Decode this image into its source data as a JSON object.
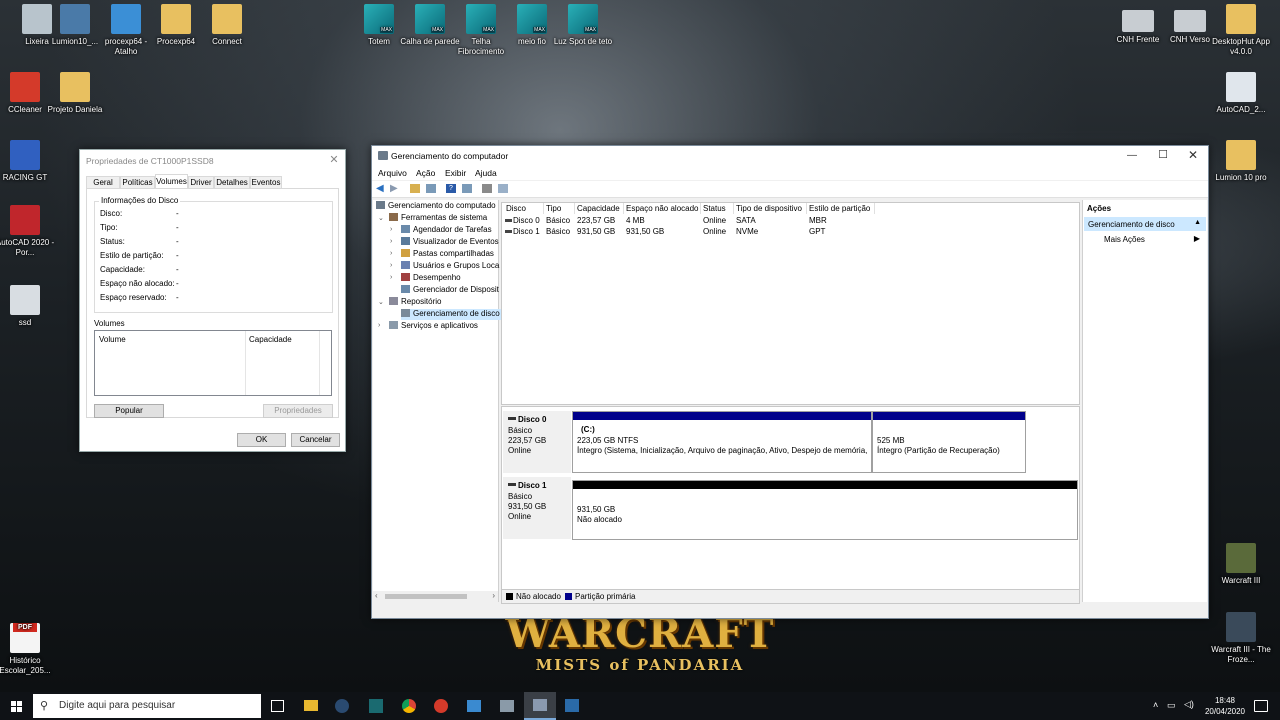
{
  "desktop": {
    "icons_left": [
      {
        "label": "Lixeira",
        "color": "#b8c4cc"
      },
      {
        "label": "Lumion10_...",
        "color": "#4a7aa8"
      },
      {
        "label": "procexp64 - Atalho",
        "color": "#3b8fd6"
      },
      {
        "label": "Procexp64",
        "color": "#e8c060"
      },
      {
        "label": "Connect",
        "color": "#e8c060"
      },
      {
        "label": "CCleaner",
        "color": "#d43a2a"
      },
      {
        "label": "Projeto Daniela",
        "color": "#e8c060"
      },
      {
        "label": "RACING GT",
        "color": "#3060c0"
      },
      {
        "label": "AutoCAD 2020 - Por...",
        "color": "#c0262c"
      },
      {
        "label": "ssd",
        "color": "#d8dde2"
      },
      {
        "label": "Histórico Escolar_205...",
        "color": "#d8dde2"
      }
    ],
    "icons_max": [
      {
        "label": "Totem"
      },
      {
        "label": "Calha de parede"
      },
      {
        "label": "Telha Fibrocimento"
      },
      {
        "label": "meio fio"
      },
      {
        "label": "Luz Spot de teto"
      }
    ],
    "max_badge": "MAX",
    "icons_right": [
      {
        "label": "CNH Frente",
        "color": "#c8cdd2"
      },
      {
        "label": "CNH Verso",
        "color": "#c8cdd2"
      },
      {
        "label": "DesktopHut App v4.0.0",
        "color": "#e8c060"
      },
      {
        "label": "AutoCAD_2...",
        "color": "#e0e6ec"
      },
      {
        "label": "Lumion 10 pro",
        "color": "#e8c060"
      },
      {
        "label": "Warcraft III",
        "color": "#5a6a3a"
      },
      {
        "label": "Warcraft III - The Froze...",
        "color": "#3a4a5a"
      }
    ],
    "pdf_badge": "PDF",
    "wallpaper_title": "WARCRAFT",
    "wallpaper_subtitle": "MISTS of PANDARIA"
  },
  "props": {
    "title": "Propriedades de CT1000P1SSD8",
    "tabs": [
      "Geral",
      "Políticas",
      "Volumes",
      "Driver",
      "Detalhes",
      "Eventos"
    ],
    "active_tab": 2,
    "group_title": "Informações do Disco",
    "rows": [
      {
        "label": "Disco:",
        "value": "-"
      },
      {
        "label": "Tipo:",
        "value": "-"
      },
      {
        "label": "Status:",
        "value": "-"
      },
      {
        "label": "Estilo de partição:",
        "value": "-"
      },
      {
        "label": "Capacidade:",
        "value": "-"
      },
      {
        "label": "Espaço não alocado:",
        "value": "-"
      },
      {
        "label": "Espaço reservado:",
        "value": "-"
      }
    ],
    "volumes_label": "Volumes",
    "vol_col1": "Volume",
    "vol_col2": "Capacidade",
    "populate": "Popular",
    "properties": "Propriedades",
    "ok": "OK",
    "cancel": "Cancelar"
  },
  "cm": {
    "title": "Gerenciamento do computador",
    "menu": [
      "Arquivo",
      "Ação",
      "Exibir",
      "Ajuda"
    ],
    "tree": [
      {
        "label": "Gerenciamento do computado",
        "level": 0,
        "exp": "",
        "color": "#6a7a8a"
      },
      {
        "label": "Ferramentas de sistema",
        "level": 1,
        "exp": "v",
        "color": "#8a6a4a"
      },
      {
        "label": "Agendador de Tarefas",
        "level": 2,
        "exp": ">",
        "color": "#6a8aaa"
      },
      {
        "label": "Visualizador de Eventos",
        "level": 2,
        "exp": ">",
        "color": "#5a7a9a"
      },
      {
        "label": "Pastas compartilhadas",
        "level": 2,
        "exp": ">",
        "color": "#d0a040"
      },
      {
        "label": "Usuários e Grupos Loca",
        "level": 2,
        "exp": ">",
        "color": "#6a80b0"
      },
      {
        "label": "Desempenho",
        "level": 2,
        "exp": ">",
        "color": "#a04040"
      },
      {
        "label": "Gerenciador de Disposit",
        "level": 2,
        "exp": "",
        "color": "#6a8aaa"
      },
      {
        "label": "Repositório",
        "level": 1,
        "exp": "v",
        "color": "#8a8a9a"
      },
      {
        "label": "Gerenciamento de disco",
        "level": 2,
        "exp": "",
        "color": "#7a8a9a",
        "selected": true
      },
      {
        "label": "Serviços e aplicativos",
        "level": 1,
        "exp": ">",
        "color": "#8a9aaa"
      }
    ],
    "columns": [
      "Disco",
      "Tipo",
      "Capacidade",
      "Espaço não alocado",
      "Status",
      "Tipo de dispositivo",
      "Estilo de partição"
    ],
    "rows": [
      [
        "Disco 0",
        "Básico",
        "223,57 GB",
        "4 MB",
        "Online",
        "SATA",
        "MBR"
      ],
      [
        "Disco 1",
        "Básico",
        "931,50 GB",
        "931,50 GB",
        "Online",
        "NVMe",
        "GPT"
      ]
    ],
    "disk0": {
      "name": "Disco 0",
      "type": "Básico",
      "size": "223,57 GB",
      "status": "Online",
      "p1_name": "(C:)",
      "p1_size": "223,05 GB NTFS",
      "p1_status": "Íntegro (Sistema, Inicialização, Arquivo de paginação, Ativo, Despejo de memória,",
      "p2_size": "525 MB",
      "p2_status": "Íntegro (Partição de Recuperação)"
    },
    "disk1": {
      "name": "Disco 1",
      "type": "Básico",
      "size": "931,50 GB",
      "status": "Online",
      "p1_size": "931,50 GB",
      "p1_status": "Não alocado"
    },
    "legend_unalloc": "Não alocado",
    "legend_primary": "Partição primária",
    "actions_title": "Ações",
    "actions_section": "Gerenciamento de disco",
    "actions_more": "Mais Ações",
    "colors": {
      "primary": "#00008b",
      "unalloc": "#000000",
      "select": "#cce8ff"
    }
  },
  "taskbar": {
    "search_placeholder": "Digite aqui para pesquisar",
    "time": "18:48",
    "date": "20/04/2020"
  }
}
